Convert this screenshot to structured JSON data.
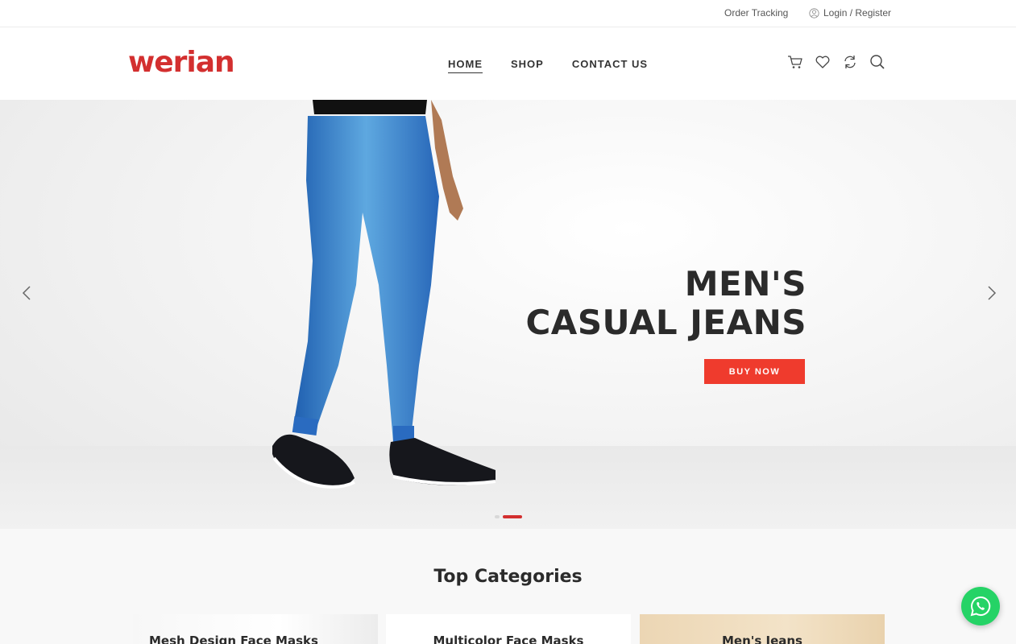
{
  "topbar": {
    "order_tracking": "Order Tracking",
    "login_register": "Login / Register"
  },
  "header": {
    "logo": "werian",
    "nav": [
      "HOME",
      "SHOP",
      "CONTACT US"
    ],
    "active_nav": "HOME",
    "icons": [
      "cart-icon",
      "heart-icon",
      "compare-icon",
      "search-icon"
    ]
  },
  "hero": {
    "heading_line1": "MEN'S",
    "heading_line2": "CASUAL JEANS",
    "button": "BUY NOW",
    "slides_total": 2,
    "active_slide": 2
  },
  "categories": {
    "title": "Top Categories",
    "items": [
      "Mesh Design Face Masks",
      "Multicolor Face Masks",
      "Men's Jeans"
    ]
  },
  "colors": {
    "brand_red": "#d32f2f",
    "button_red": "#ef3b2d",
    "whatsapp_green": "#25d366"
  }
}
